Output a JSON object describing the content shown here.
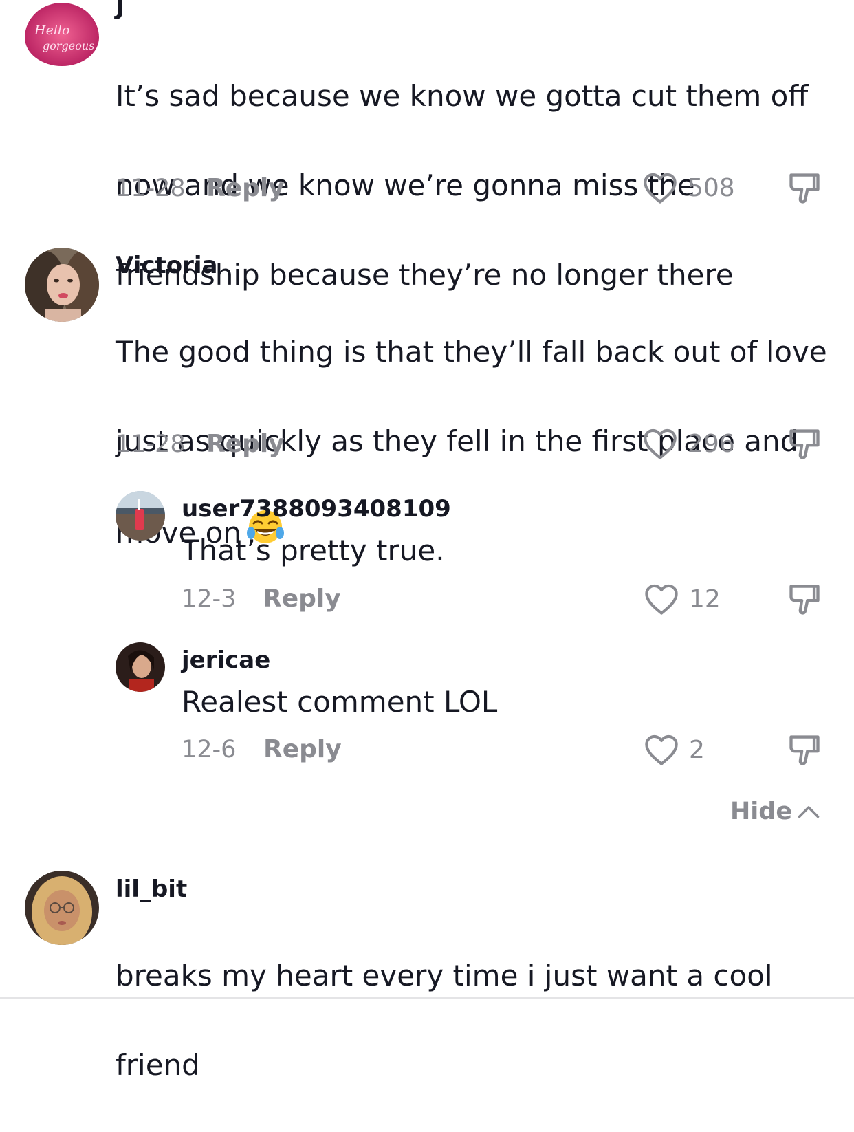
{
  "comments": [
    {
      "username": "J",
      "avatar_text": [
        "Hello",
        "gorgeous"
      ],
      "text_lines": [
        "It’s sad because we know we gotta cut them off",
        "now and we know we’re gonna miss the",
        "friendship because they’re no longer there"
      ],
      "date": "11-28",
      "reply_label": "Reply",
      "likes": "508"
    },
    {
      "username": "Victoria",
      "text_lines": [
        "The good thing is that they’ll fall back out of love",
        "just as quickly as they fell in the first place and",
        "move on"
      ],
      "emoji": "face-with-tears-of-joy",
      "date": "11-28",
      "reply_label": "Reply",
      "likes": "296",
      "replies": [
        {
          "username": "user7388093408109",
          "text": "That’s pretty true.",
          "date": "12-3",
          "reply_label": "Reply",
          "likes": "12"
        },
        {
          "username": "jericae",
          "text": "Realest comment LOL",
          "date": "12-6",
          "reply_label": "Reply",
          "likes": "2"
        }
      ],
      "hide_label": "Hide"
    },
    {
      "username": "lil_bit",
      "text_lines": [
        "breaks my heart every time i just want a cool",
        "friend"
      ]
    }
  ],
  "icons": {
    "like": "heart-outline-icon",
    "dislike": "thumbs-down-icon",
    "hide": "chevron-up-icon"
  },
  "colors": {
    "text": "#161823",
    "secondary": "#8a8b91",
    "avatar_pink": "#c2185b"
  }
}
